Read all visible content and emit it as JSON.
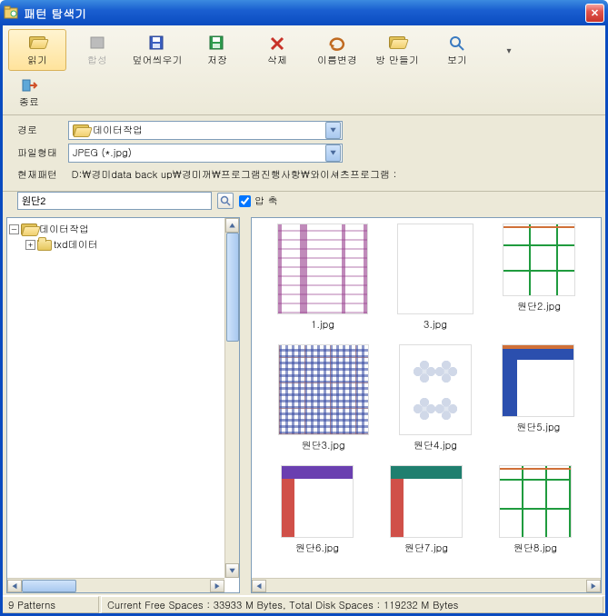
{
  "window": {
    "title": "패턴 탐색기"
  },
  "toolbar": {
    "read": "읽기",
    "compose": "합성",
    "overwrite": "덮어씌우기",
    "save": "저장",
    "delete": "삭제",
    "rename": "이름변경",
    "make_room": "방 만들기",
    "view": "보기",
    "exit": "종료"
  },
  "form": {
    "path_label": "경로",
    "path_value": "데이터작업",
    "filetype_label": "파일형태",
    "filetype_value": "JPEG (*.jpg)",
    "current_pattern_label": "현재패턴",
    "current_path": "D:\\경미data back up\\경미꺼\\프로그램진행사항\\와이셔츠프로그램 :"
  },
  "search": {
    "value": "원단2",
    "compress_label": "압 축"
  },
  "tree": {
    "root": "데이터작업",
    "child1": "txd데이터"
  },
  "thumbs": [
    {
      "name": "1.jpg"
    },
    {
      "name": "3.jpg"
    },
    {
      "name": "원단2.jpg"
    },
    {
      "name": "원단3.jpg"
    },
    {
      "name": "원단4.jpg"
    },
    {
      "name": "원단5.jpg"
    },
    {
      "name": "원단6.jpg"
    },
    {
      "name": "원단7.jpg"
    },
    {
      "name": "원단8.jpg"
    }
  ],
  "status": {
    "count": "9  Patterns",
    "disk": "Current Free Spaces :  33933 M Bytes, Total Disk Spaces :  119232 M Bytes"
  }
}
